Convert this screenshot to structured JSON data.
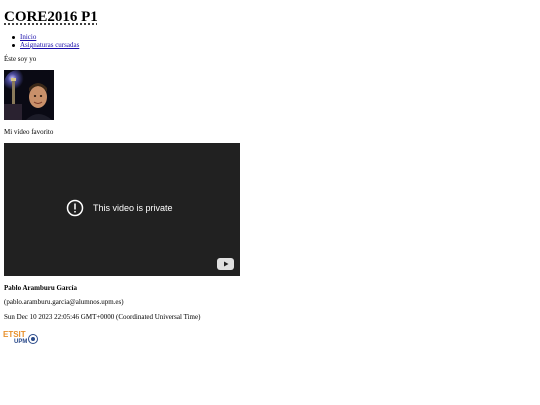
{
  "header": {
    "title": "CORE2016 P1"
  },
  "nav": {
    "items": [
      {
        "label": "Inicio"
      },
      {
        "label": "Asignaturas cursadas"
      }
    ]
  },
  "profile": {
    "intro": "Éste soy yo",
    "video_label": "Mi vídeo favorito"
  },
  "video": {
    "message": "This video is private",
    "icon": "youtube-icon"
  },
  "footer": {
    "author": "Pablo Aramburu García",
    "email": "(pablo.aramburu.garcia@alumnos.upm.es)",
    "date": "Sun Dec 10 2023 22:05:46 GMT+0000 (Coordinated Universal Time)",
    "logo_text": "ETSIT UPM"
  },
  "colors": {
    "link": "#1a0dab",
    "video_bg": "#212121",
    "logo_orange": "#e8902a",
    "logo_blue": "#2a4a8a"
  }
}
